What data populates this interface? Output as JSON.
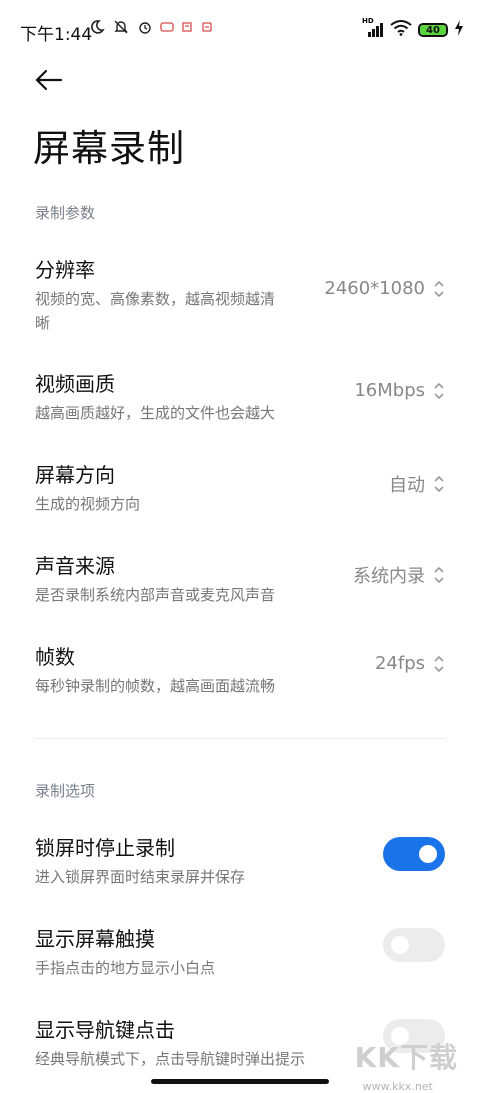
{
  "status_bar": {
    "time": "下午1:44",
    "battery": "40",
    "network": "HD"
  },
  "header": {
    "title": "屏幕录制"
  },
  "sections": {
    "params_label": "录制参数",
    "options_label": "录制选项"
  },
  "params": [
    {
      "title": "分辨率",
      "subtitle": "视频的宽、高像素数，越高视频越清\n晰",
      "value": "2460*1080"
    },
    {
      "title": "视频画质",
      "subtitle": "越高画质越好，生成的文件也会越大",
      "value": "16Mbps"
    },
    {
      "title": "屏幕方向",
      "subtitle": "生成的视频方向",
      "value": "自动"
    },
    {
      "title": "声音来源",
      "subtitle": "是否录制系统内部声音或麦克风声音",
      "value": "系统内录"
    },
    {
      "title": "帧数",
      "subtitle": "每秒钟录制的帧数，越高画面越流畅",
      "value": "24fps"
    }
  ],
  "options": [
    {
      "title": "锁屏时停止录制",
      "subtitle": "进入锁屏界面时结束录屏并保存",
      "enabled": true
    },
    {
      "title": "显示屏幕触摸",
      "subtitle": "手指点击的地方显示小白点",
      "enabled": false
    },
    {
      "title": "显示导航键点击",
      "subtitle": "经典导航模式下，点击导航键时弹出提示",
      "enabled": false
    }
  ],
  "watermark": {
    "brand": "KK下载",
    "url": "www.kkx.net"
  },
  "colors": {
    "accent": "#1a73e8",
    "toggle_off": "#ececec",
    "section_label": "#7a7f8c"
  }
}
